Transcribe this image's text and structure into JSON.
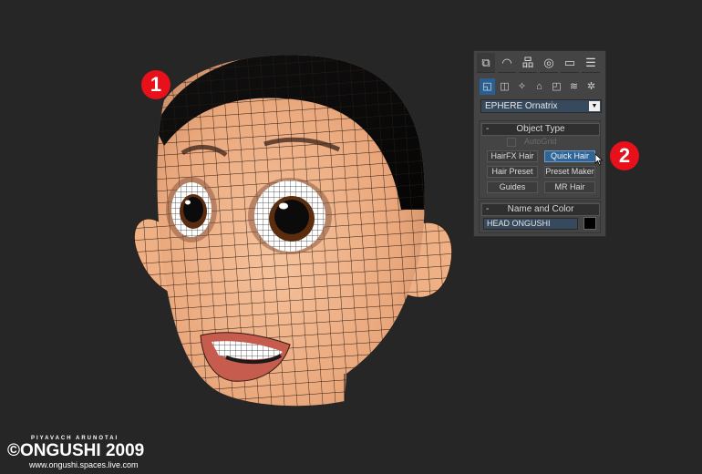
{
  "callouts": [
    "1",
    "2"
  ],
  "panel": {
    "tabs": [
      {
        "name": "create",
        "glyph": "⧉",
        "active": true
      },
      {
        "name": "modify",
        "glyph": "◠"
      },
      {
        "name": "hierarchy",
        "glyph": "品"
      },
      {
        "name": "motion",
        "glyph": "◎"
      },
      {
        "name": "display",
        "glyph": "▭"
      },
      {
        "name": "utilities",
        "glyph": "☰"
      }
    ],
    "subcategories": [
      {
        "name": "geometry",
        "glyph": "◱",
        "active": true
      },
      {
        "name": "shapes",
        "glyph": "◫"
      },
      {
        "name": "lights",
        "glyph": "✧"
      },
      {
        "name": "cameras",
        "glyph": "⌂"
      },
      {
        "name": "helpers",
        "glyph": "◰"
      },
      {
        "name": "spacewarps",
        "glyph": "≋"
      },
      {
        "name": "systems",
        "glyph": "✲"
      }
    ],
    "category_value": "EPHERE Ornatrix",
    "object_type": {
      "header": "Object Type",
      "collapse": "-",
      "autogrid_label": "AutoGrid",
      "autogrid_checked": false,
      "buttons": [
        "HairFX Hair",
        "Quick Hair",
        "Hair Preset",
        "Preset Maker",
        "Guides",
        "MR Hair"
      ],
      "active_button": "Quick Hair"
    },
    "name_and_color": {
      "header": "Name and Color",
      "collapse": "-",
      "name_value": "HEAD ONGUSHI",
      "color": "#000000"
    }
  },
  "watermark": {
    "author": "PIYAVACH ARUNOTAI",
    "main": "©ONGUSHI 2009",
    "url": "www.ongushi.spaces.live.com"
  },
  "colors": {
    "callout": "#e8101a",
    "skin": "#f2b48a",
    "hair": "#0c0c0c",
    "accent": "#2f6597"
  }
}
